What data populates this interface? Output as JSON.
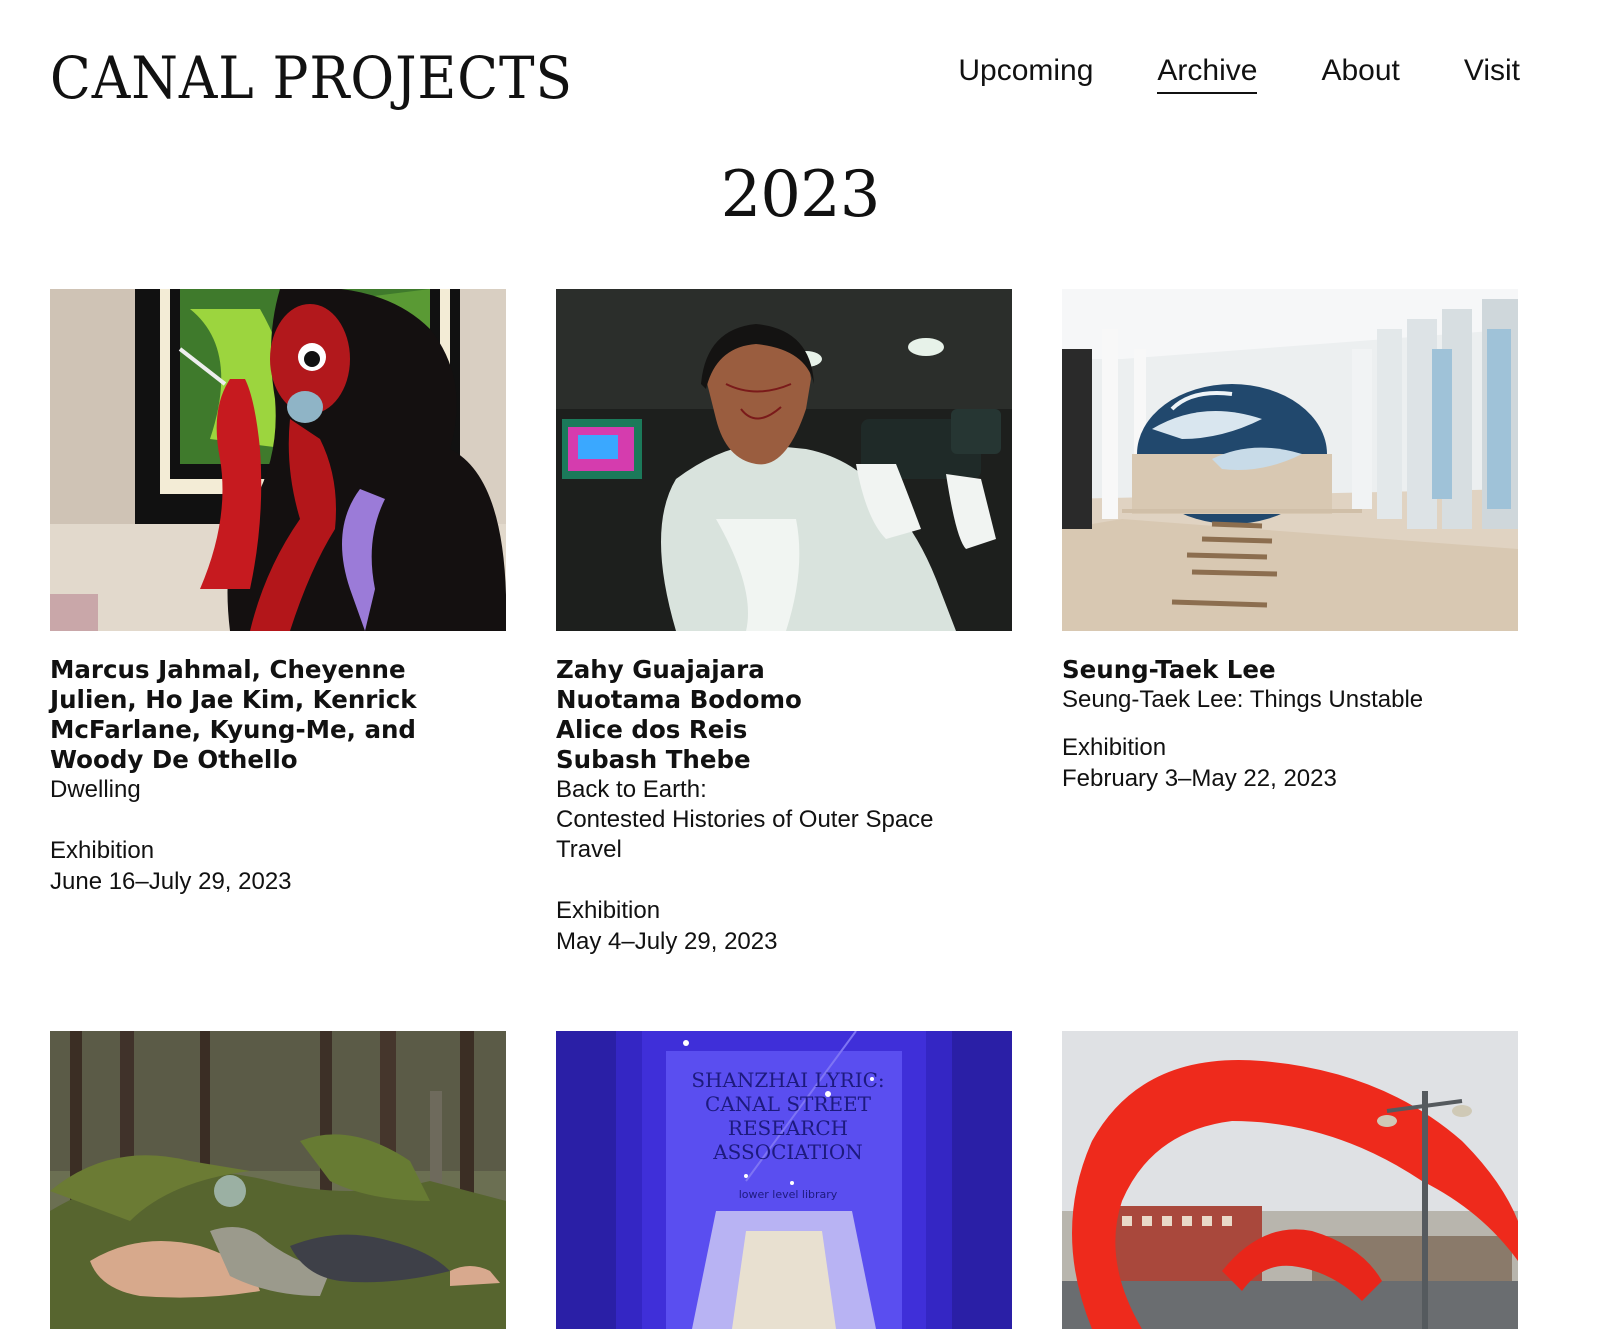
{
  "header": {
    "logo": "CANAL PROJECTS",
    "nav": [
      {
        "label": "Upcoming"
      },
      {
        "label": "Archive",
        "active": true
      },
      {
        "label": "About"
      },
      {
        "label": "Visit"
      }
    ]
  },
  "year": "2023",
  "cards": [
    {
      "artists": [
        "Marcus Jahmal, Cheyenne",
        "Julien, Ho Jae Kim, Kenrick",
        "McFarlane, Kyung-Me, and",
        "Woody De Othello"
      ],
      "title_lines": [
        "Dwelling"
      ],
      "kind": "Exhibition",
      "dates": "June 16–July 29, 2023"
    },
    {
      "artists": [
        "Zahy Guajajara",
        "Nuotama Bodomo",
        "Alice dos Reis",
        "Subash Thebe"
      ],
      "title_lines": [
        "Back to Earth:",
        "Contested Histories of Outer Space",
        "Travel"
      ],
      "kind": "Exhibition",
      "dates": "May 4–July 29, 2023"
    },
    {
      "artists": [
        "Seung-Taek Lee"
      ],
      "title_lines": [
        "Seung-Taek Lee: Things Unstable"
      ],
      "kind": "Exhibition",
      "dates": "February 3–May 22, 2023"
    },
    {
      "image": "forest-figures-photo"
    },
    {
      "image": "library-entrance-photo",
      "sign_lines": [
        "SHANZHAI LYRIC:",
        "CANAL STREET",
        "RESEARCH",
        "ASSOCIATION"
      ],
      "sign_small": "lower level library"
    },
    {
      "image": "red-fabric-performance-photo"
    }
  ]
}
